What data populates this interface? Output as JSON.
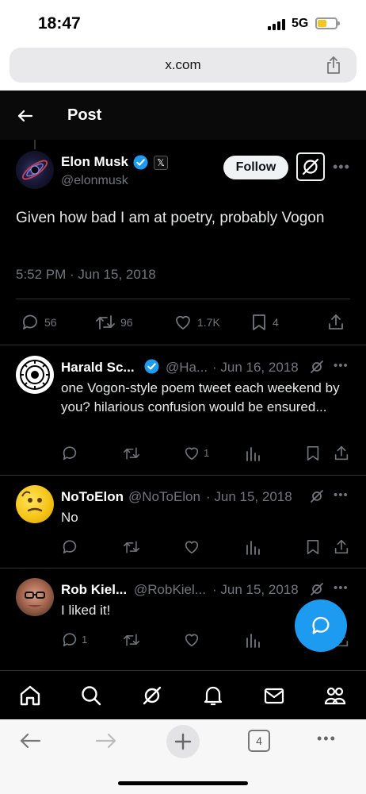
{
  "status_bar": {
    "time": "18:47",
    "network": "5G",
    "battery_color": "#f3c623"
  },
  "browser": {
    "url": "x.com",
    "tab_count": "4"
  },
  "header": {
    "title": "Post"
  },
  "main_post": {
    "name": "Elon Musk",
    "handle": "@elonmusk",
    "follow_label": "Follow",
    "text": "Given how bad I am at poetry, probably Vogon",
    "timestamp": "5:52 PM · Jun 15, 2018",
    "stats": {
      "replies": "56",
      "reposts": "96",
      "likes": "1.7K",
      "bookmarks": "4"
    }
  },
  "replies": [
    {
      "name": "Harald Sc...",
      "handle": "@Ha...",
      "date": "· Jun 16, 2018",
      "text": "one Vogon-style poem tweet each weekend by you? hilarious confusion would be ensured...",
      "reply_count": "",
      "like_count": "1"
    },
    {
      "name": "NoToElon",
      "handle": "@NoToElon",
      "date": "· Jun 15, 2018",
      "text": "No",
      "reply_count": "",
      "like_count": ""
    },
    {
      "name": "Rob Kiel...",
      "handle": "@RobKiel...",
      "date": "· Jun 15, 2018",
      "text": "I liked it!",
      "reply_count": "1",
      "like_count": ""
    }
  ],
  "colors": {
    "accent": "#1d9bf0",
    "background": "#000000",
    "muted": "#71767b"
  }
}
